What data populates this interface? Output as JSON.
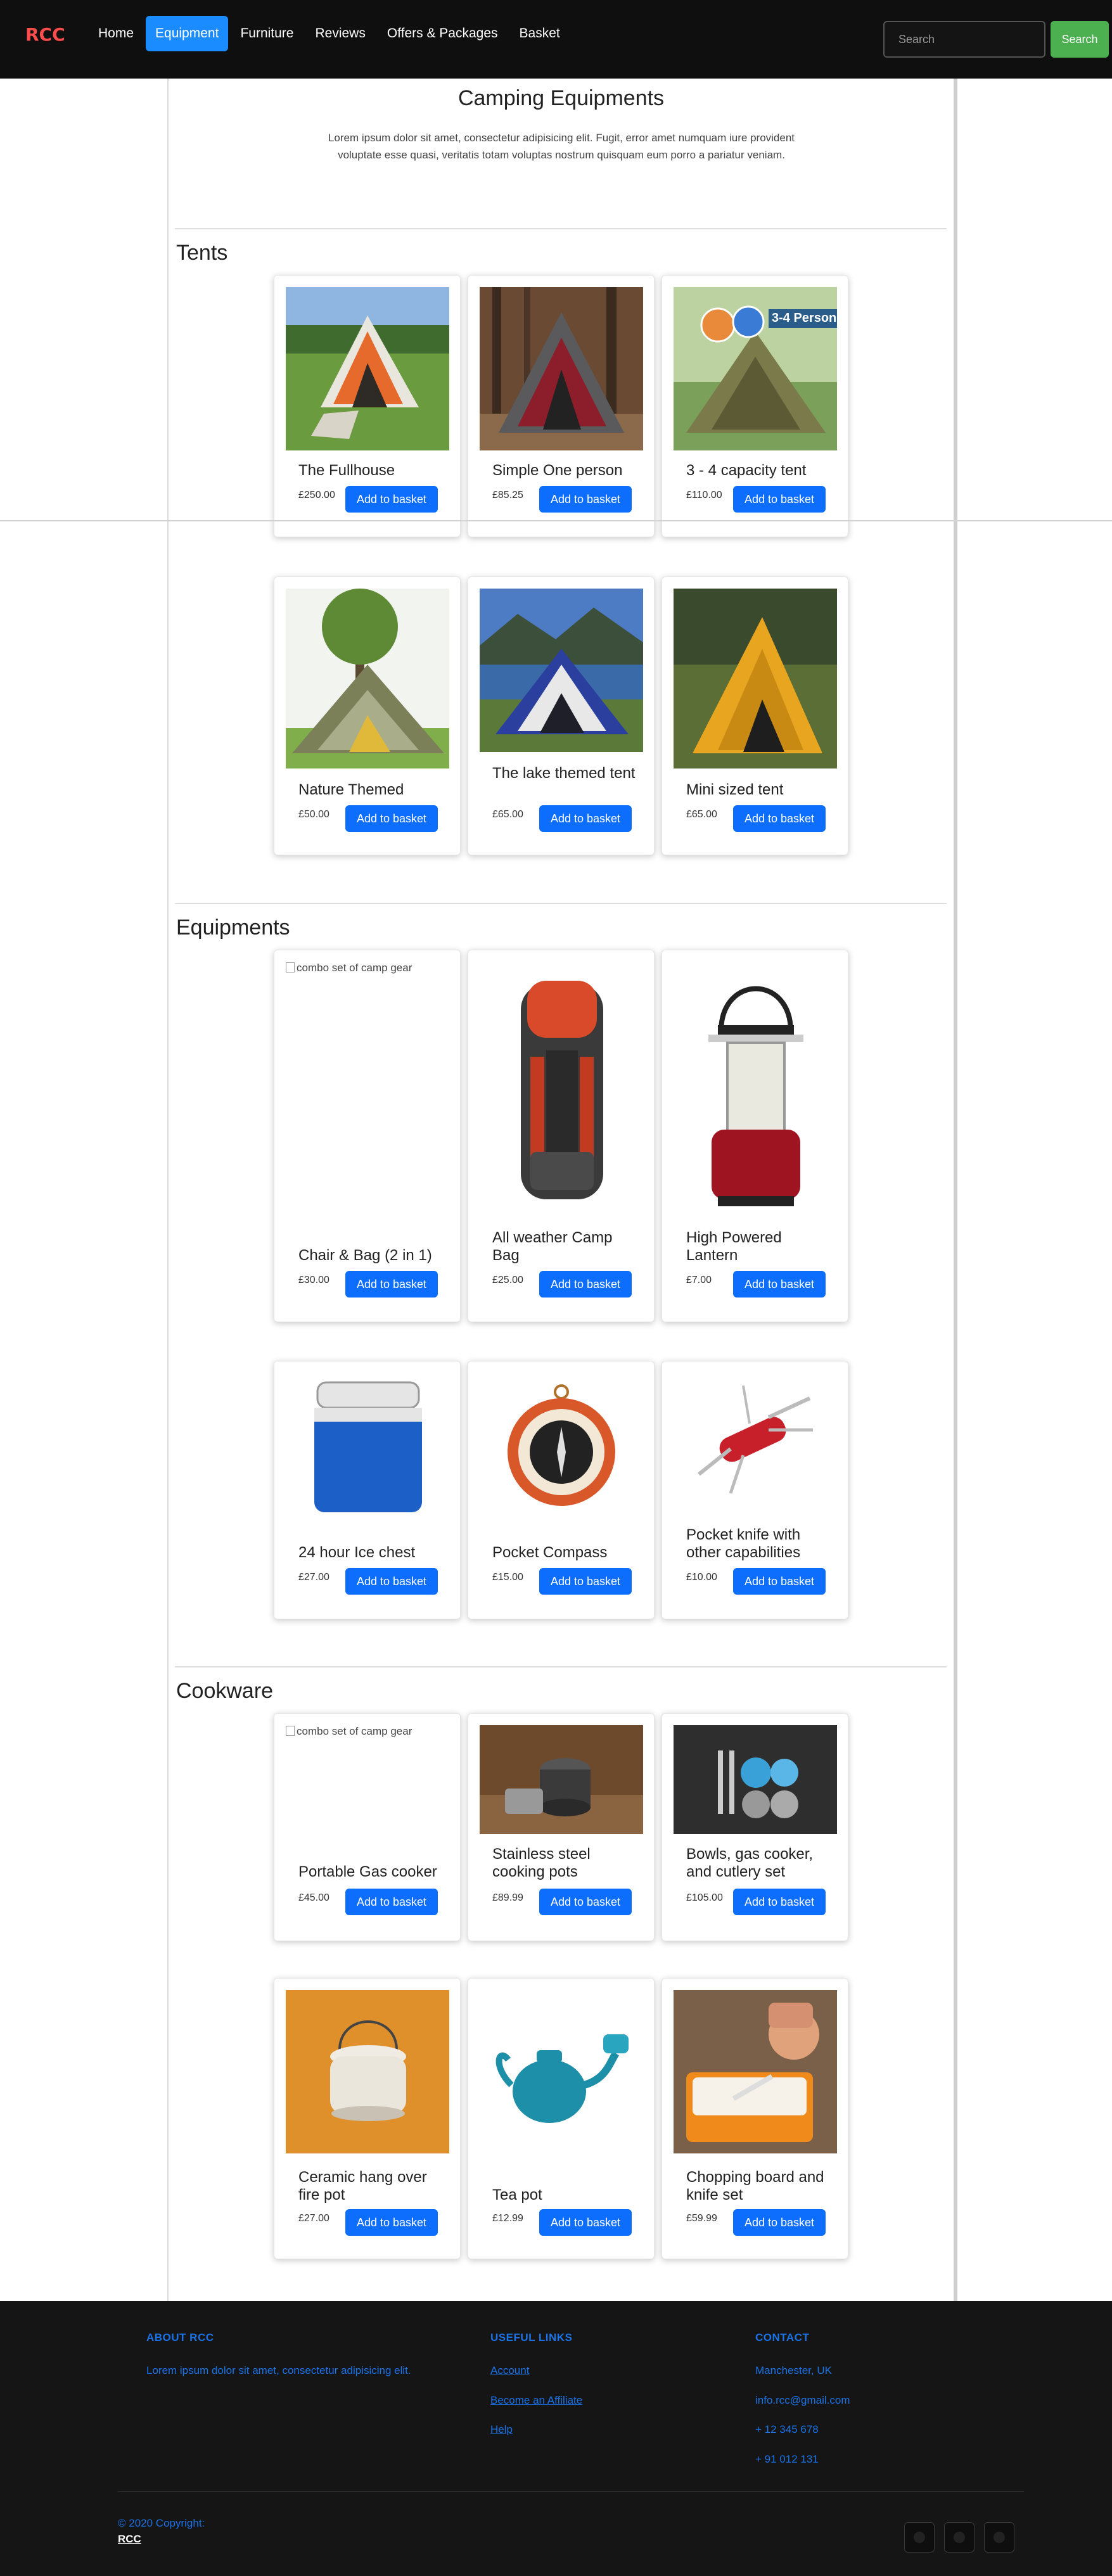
{
  "nav": {
    "brand": "RCC",
    "links": [
      "Home",
      "Equipment",
      "Furniture",
      "Reviews",
      "Offers & Packages",
      "Basket"
    ],
    "active": "Equipment",
    "search_placeholder": "Search",
    "search_button": "Search"
  },
  "header": {
    "title": "Camping Equipments",
    "intro": "Lorem ipsum dolor sit amet, consectetur adipisicing elit. Fugit, error amet numquam iure provident voluptate esse quasi, veritatis totam voluptas nostrum quisquam eum porro a pariatur veniam."
  },
  "add_label": "Add to basket",
  "sections": {
    "tents": {
      "title": "Tents",
      "items": [
        {
          "name": "The Fullhouse",
          "price": "£250.00",
          "image": "tent-image"
        },
        {
          "name": "Simple One person",
          "price": "£85.25",
          "image": "tent-image"
        },
        {
          "name": "3 - 4 capacity tent",
          "price": "£110.00",
          "image": "tent-image",
          "badge": "3-4 Person"
        },
        {
          "name": "Nature Themed",
          "price": "£50.00",
          "image": "tent-image"
        },
        {
          "name": "The lake themed tent",
          "price": "£65.00",
          "image": "tent-image"
        },
        {
          "name": "Mini sized tent",
          "price": "£65.00",
          "image": "tent-image"
        }
      ]
    },
    "equipments": {
      "title": "Equipments",
      "items": [
        {
          "name": "Chair & Bag (2 in 1)",
          "price": "£30.00",
          "alt": "combo set of camp gear"
        },
        {
          "name": "All weather Camp Bag",
          "price": "£25.00",
          "image": "backpack-image"
        },
        {
          "name": "High Powered Lantern",
          "price": "£7.00",
          "image": "lantern-image"
        },
        {
          "name": "24 hour Ice chest",
          "price": "£27.00",
          "image": "cooler-image"
        },
        {
          "name": "Pocket Compass",
          "price": "£15.00",
          "image": "compass-image"
        },
        {
          "name": "Pocket knife with other capabilities",
          "price": "£10.00",
          "image": "knife-image"
        }
      ]
    },
    "cookware": {
      "title": "Cookware",
      "items": [
        {
          "name": "Portable Gas cooker",
          "price": "£45.00",
          "alt": "combo set of camp gear"
        },
        {
          "name": "Stainless steel cooking pots",
          "price": "£89.99",
          "image": "pots-image"
        },
        {
          "name": "Bowls, gas cooker, and cutlery set",
          "price": "£105.00",
          "image": "bowls-image"
        },
        {
          "name": "Ceramic hang over fire pot",
          "price": "£27.00",
          "image": "ceramic-pot-image"
        },
        {
          "name": "Tea pot",
          "price": "£12.99",
          "image": "teapot-image"
        },
        {
          "name": "Chopping board and knife set",
          "price": "£59.99",
          "image": "chopping-board-image"
        }
      ]
    }
  },
  "footer": {
    "about_title": "ABOUT RCC",
    "about_text": "Lorem ipsum dolor sit amet, consectetur adipisicing elit.",
    "links_title": "USEFUL LINKS",
    "links": [
      "Account",
      "Become an Affiliate",
      "Help"
    ],
    "contact_title": "CONTACT",
    "contact": [
      "Manchester, UK",
      "info.rcc@gmail.com",
      "+ 12 345 678",
      "+ 91 012 131"
    ],
    "copyright": "© 2020 Copyright:",
    "copyright_brand": "RCC",
    "social_icons": [
      "facebook-icon",
      "twitter-icon",
      "instagram-icon"
    ]
  }
}
